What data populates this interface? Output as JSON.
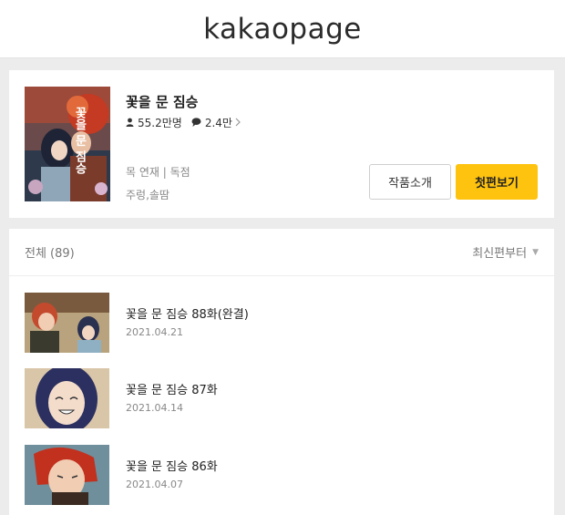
{
  "header": {
    "logo": "kakaopage"
  },
  "series": {
    "title": "꽃을 문 짐승",
    "views": "55.2만명",
    "comments": "2.4만",
    "schedule": "목 연재 | 독점",
    "authors": "주렁,솔땀",
    "cover_text": "꽃을 문 짐승",
    "intro_button": "작품소개",
    "first_button": "첫편보기"
  },
  "episodes": {
    "total_label": "전체 (89)",
    "sort_label": "최신편부터",
    "items": [
      {
        "title": "꽃을 문 짐승 88화(완결)",
        "date": "2021.04.21"
      },
      {
        "title": "꽃을 문 짐승 87화",
        "date": "2021.04.14"
      },
      {
        "title": "꽃을 문 짐승 86화",
        "date": "2021.04.07"
      }
    ]
  },
  "colors": {
    "accent": "#fec30f",
    "background": "#ececec"
  },
  "icons": {
    "views": "person-icon",
    "comments": "speech-bubble-icon",
    "more": "chevron-right-icon",
    "sort": "triangle-down-icon"
  }
}
